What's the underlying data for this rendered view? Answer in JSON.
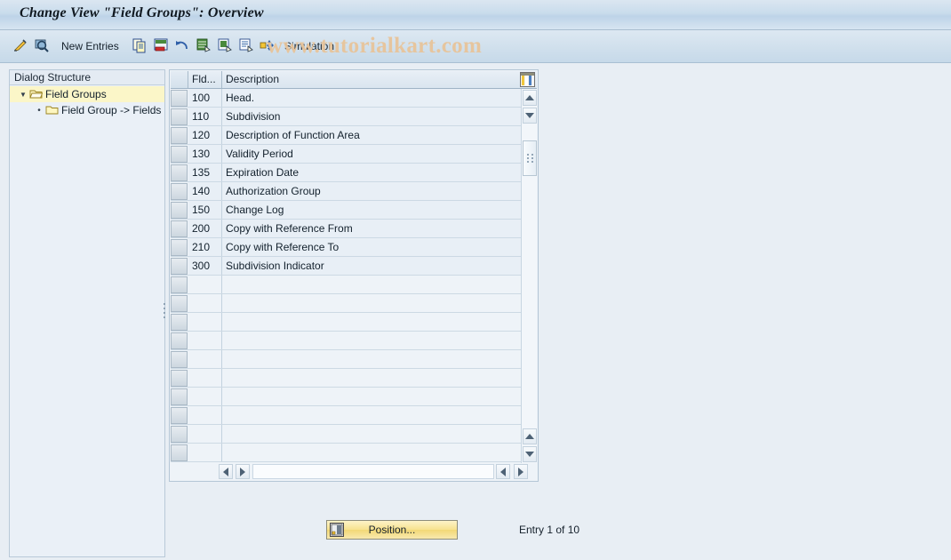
{
  "window": {
    "title": "Change View \"Field Groups\": Overview"
  },
  "watermark": {
    "text": "www.tutorialkart.com",
    "color": "#e8c49a"
  },
  "toolbar": {
    "items": [
      {
        "name": "change-display-icon",
        "label": "",
        "icon": "pencil-icon"
      },
      {
        "name": "display-details-icon",
        "label": "",
        "icon": "magnifier-icon"
      },
      {
        "name": "new-entries-button",
        "label": "New Entries",
        "icon": ""
      },
      {
        "name": "copy-as-icon",
        "label": "",
        "icon": "copy-icon"
      },
      {
        "name": "delete-icon",
        "label": "",
        "icon": "delete-row-icon"
      },
      {
        "name": "undo-icon",
        "label": "",
        "icon": "undo-arrow-icon"
      },
      {
        "name": "select-all-icon",
        "label": "",
        "icon": "select-all-icon"
      },
      {
        "name": "deselect-all-icon",
        "label": "",
        "icon": "deselect-all-icon"
      },
      {
        "name": "select-block-icon",
        "label": "",
        "icon": "select-block-icon"
      },
      {
        "name": "simulation-button",
        "label": "Simulation",
        "icon": "transport-icon"
      }
    ],
    "new_entries_label": "New Entries",
    "simulation_label": "Simulation"
  },
  "sidebar": {
    "header": "Dialog Structure",
    "items": [
      {
        "label": "Field Groups",
        "selected": true,
        "level": 0,
        "expanded": true
      },
      {
        "label": "Field Group -> Fields",
        "selected": false,
        "level": 1,
        "expanded": false
      }
    ]
  },
  "table": {
    "columns": [
      {
        "key": "select",
        "label": ""
      },
      {
        "key": "fld",
        "label": "Fld..."
      },
      {
        "key": "description",
        "label": "Description"
      }
    ],
    "config_icon": "table-settings-icon",
    "rows": [
      {
        "fld": "100",
        "description": "Head."
      },
      {
        "fld": "110",
        "description": "Subdivision"
      },
      {
        "fld": "120",
        "description": "Description of Function Area"
      },
      {
        "fld": "130",
        "description": "Validity Period"
      },
      {
        "fld": "135",
        "description": "Expiration Date"
      },
      {
        "fld": "140",
        "description": "Authorization Group"
      },
      {
        "fld": "150",
        "description": "Change Log"
      },
      {
        "fld": "200",
        "description": "Copy with Reference From"
      },
      {
        "fld": "210",
        "description": "Copy with Reference To"
      },
      {
        "fld": "300",
        "description": "Subdivision Indicator"
      }
    ],
    "empty_row_count": 10
  },
  "footer": {
    "position_button_label": "Position...",
    "entry_status": "Entry 1 of 10"
  },
  "colors": {
    "titlebar_top": "#dbe6f1",
    "titlebar_bottom": "#d7e5f1",
    "page_background": "#e8eef4",
    "row_background": "#e8eff6",
    "selection_highlight": "#fbf6c8",
    "button_accent": "#f7e28e"
  }
}
